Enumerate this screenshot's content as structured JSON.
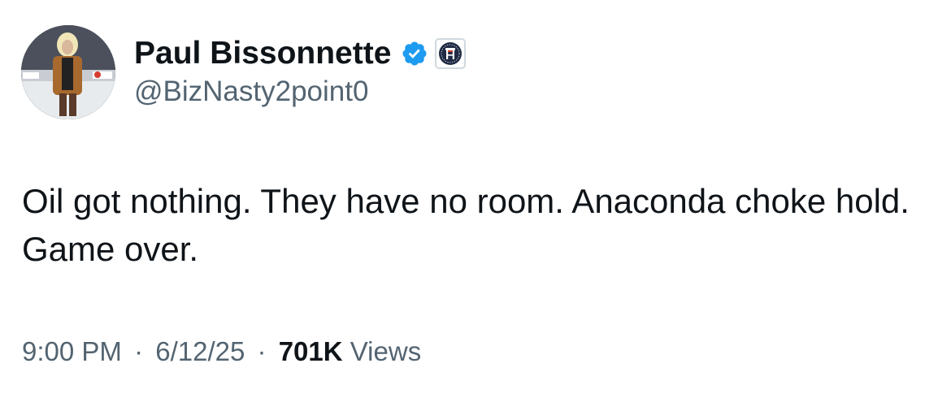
{
  "author": {
    "display_name": "Paul Bissonnette",
    "handle": "@BizNasty2point0",
    "verified_icon": "verified-checkmark-icon",
    "affiliate_icon": "barstool-badge-icon",
    "verified_color": "#1d9bf0"
  },
  "tweet": {
    "text": "Oil got nothing. They have no room. Anaconda choke hold. Game over."
  },
  "meta": {
    "time": "9:00 PM",
    "separator": "·",
    "date": "6/12/25",
    "views_count": "701K",
    "views_label": "Views"
  },
  "colors": {
    "text": "#0f1419",
    "secondary": "#536471"
  }
}
